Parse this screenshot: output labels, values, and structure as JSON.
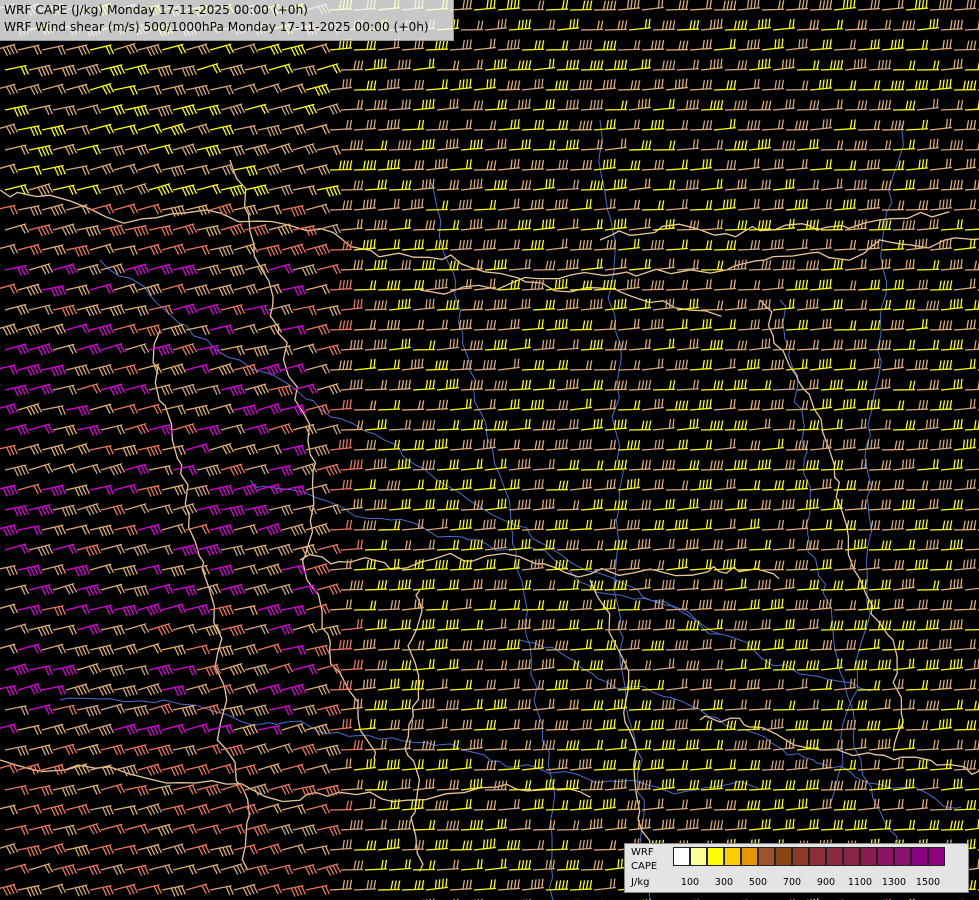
{
  "header": {
    "line1": "WRF CAPE (J/kg) Monday 17-11-2025 00:00 (+0h)",
    "line2": "WRF Wind shear (m/s) 500/1000hPa Monday 17-11-2025 00:00 (+0h)"
  },
  "legend": {
    "label1": "WRF",
    "label2": "CAPE",
    "label3": "J/kg",
    "colors": [
      "#ffffff",
      "#ffff99",
      "#ffff00",
      "#ffcc00",
      "#e69500",
      "#a0522d",
      "#8b4513",
      "#8b3a2a",
      "#8b2f3a",
      "#8b2a3f",
      "#8b2348",
      "#8b1c50",
      "#8b1560",
      "#8b0e70",
      "#8b0080",
      "#90007f"
    ],
    "ticks": [
      "100",
      "300",
      "500",
      "700",
      "900",
      "1100",
      "1300",
      "1500"
    ]
  },
  "map": {
    "barb_colors": [
      "#ffff00",
      "#e0b070",
      "#d2a679",
      "#e8785a",
      "#dd00dd",
      "#c9a07a"
    ],
    "border_color": "#e8c89a",
    "river_color": "#4a6ed0"
  }
}
